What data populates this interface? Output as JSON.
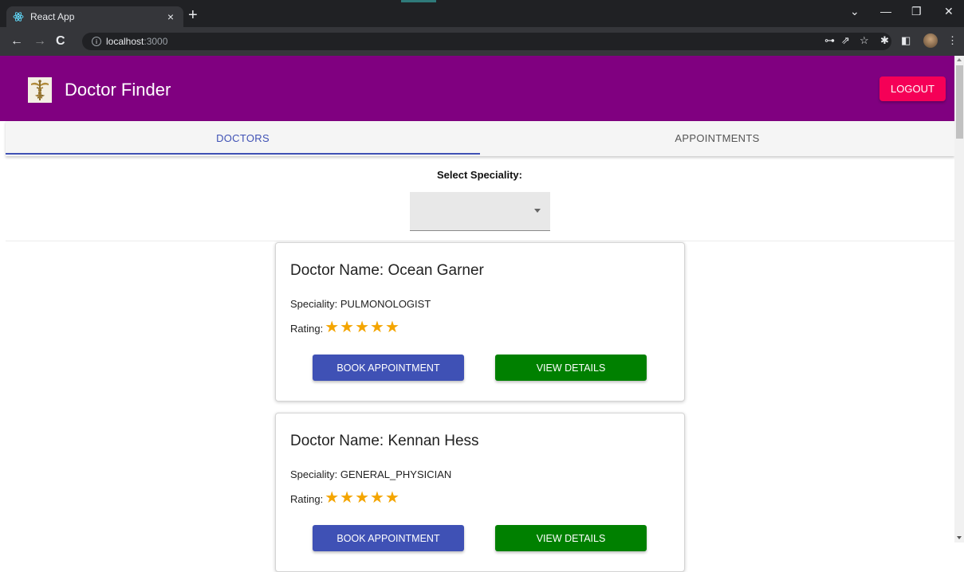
{
  "browser": {
    "tab_title": "React App",
    "tab_close": "×",
    "new_tab": "+",
    "url_host": "localhost",
    "url_port": ":3000"
  },
  "app": {
    "title": "Doctor Finder",
    "logout_label": "LOGOUT"
  },
  "tabs": [
    {
      "label": "DOCTORS",
      "selected": true
    },
    {
      "label": "APPOINTMENTS",
      "selected": false
    }
  ],
  "filter": {
    "label": "Select Speciality:",
    "value": ""
  },
  "doctors": [
    {
      "name": "Doctor Name: Ocean Garner",
      "speciality": "Speciality: PULMONOLOGIST",
      "rating_label": "Rating:",
      "rating": 5,
      "book_label": "BOOK APPOINTMENT",
      "view_label": "VIEW DETAILS"
    },
    {
      "name": "Doctor Name: Kennan Hess",
      "speciality": "Speciality: GENERAL_PHYSICIAN",
      "rating_label": "Rating:",
      "rating": 5,
      "book_label": "BOOK APPOINTMENT",
      "view_label": "VIEW DETAILS"
    }
  ],
  "icons": {
    "favicon": "react-icon",
    "back": "back-arrow-icon",
    "forward": "forward-arrow-icon",
    "reload": "reload-icon",
    "info": "info-icon",
    "key": "key-icon",
    "share": "share-icon",
    "bookmark": "star-icon",
    "extensions": "puzzle-icon",
    "sidepanel": "side-panel-icon",
    "menu": "kebab-menu-icon",
    "logo": "caduceus-icon",
    "select_caret": "caret-down-icon",
    "rating_star": "star-icon"
  },
  "colors": {
    "appbar": "#800080",
    "logout": "#f50057",
    "primary": "#3f51b5",
    "view_button": "#008000",
    "star": "#f4a500"
  }
}
